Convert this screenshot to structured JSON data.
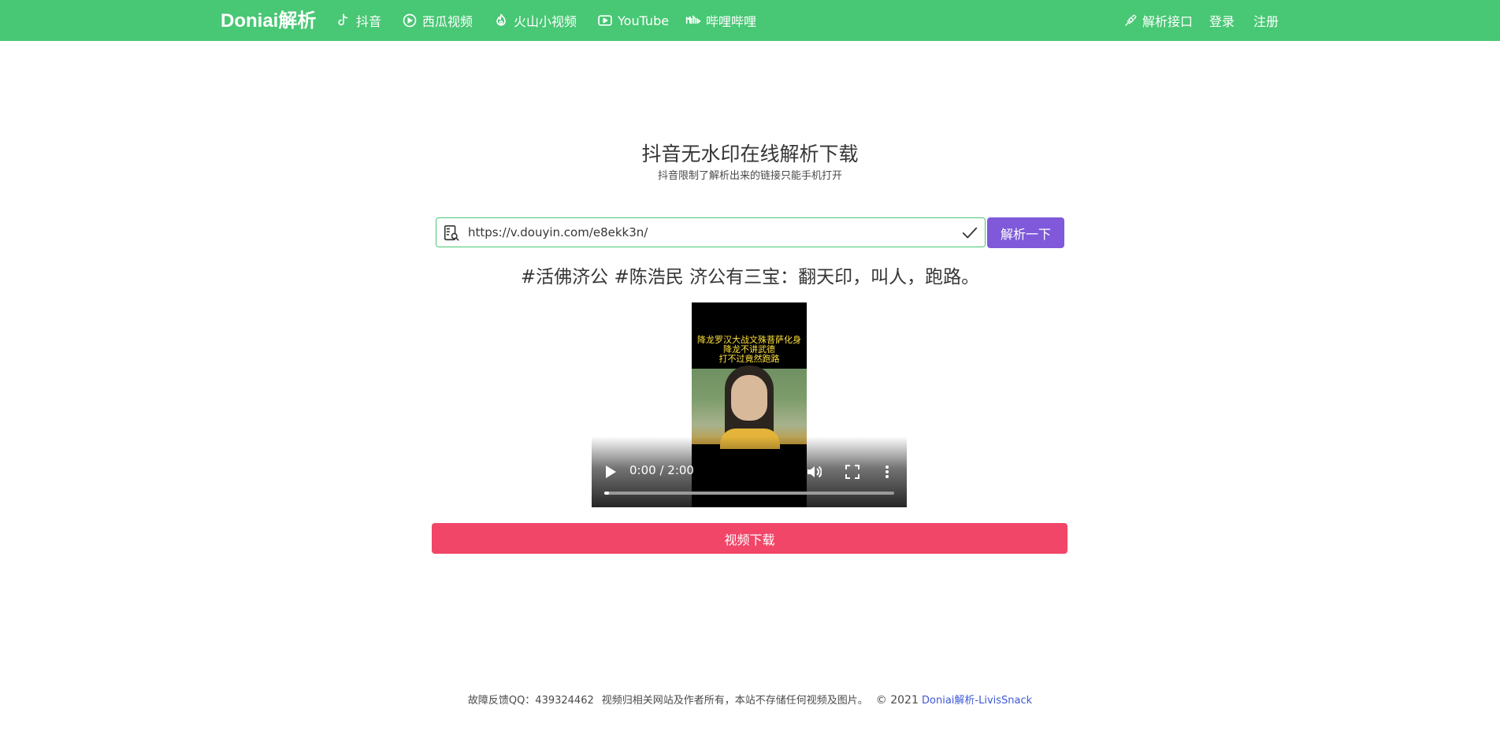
{
  "navbar": {
    "brand": "Doniai解析",
    "items": [
      {
        "label": "抖音",
        "icon": "tiktok-icon"
      },
      {
        "label": "西瓜视频",
        "icon": "xigua-icon"
      },
      {
        "label": "火山小视频",
        "icon": "huoshan-icon"
      },
      {
        "label": "YouTube",
        "icon": "youtube-icon"
      },
      {
        "label": "哔哩哔哩",
        "icon": "bilibili-icon"
      }
    ],
    "right": {
      "api_label": "解析接口",
      "login_label": "登录",
      "register_label": "注册"
    },
    "color": "#48c774"
  },
  "hero": {
    "title": "抖音无水印在线解析下载",
    "subtitle": "抖音限制了解析出来的链接只能手机打开"
  },
  "search": {
    "value": "https://v.douyin.com/e8ekk3n/",
    "button_label": "解析一下",
    "button_color": "#7f59d9"
  },
  "result": {
    "title": "#活佛济公 #陈浩民 济公有三宝：翻天印，叫人，跑路。",
    "video": {
      "caption_lines": [
        "降龙罗汉大战文殊菩萨化身",
        "降龙不讲武德",
        "打不过竟然跑路"
      ],
      "time_display": "0:00 / 2:00",
      "progress": 0
    },
    "download_label": "视频下载",
    "download_color": "#f14668"
  },
  "footer": {
    "feedback": "故障反馈QQ：439324462",
    "disclaimer": "视频归相关网站及作者所有，本站不存储任何视频及图片。",
    "copyright": "© 2021",
    "link_text": "Doniai解析-LivisSnack"
  }
}
